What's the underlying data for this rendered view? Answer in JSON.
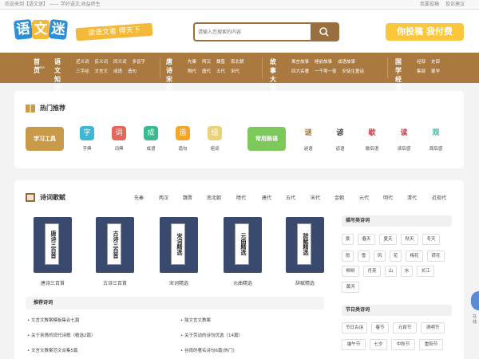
{
  "topbar": {
    "welcome": "欢迎来到【语文迷】 —— 学好语文,收益终生",
    "links": [
      "我要投稿",
      "投诉建议"
    ]
  },
  "header": {
    "logo": [
      "语",
      "文",
      "迷"
    ],
    "slogan": "读语文者 得天下",
    "search_placeholder": "请输入您搜索的内容",
    "submit": "你投稿 我付费"
  },
  "nav": [
    {
      "main": "首页",
      "sub": "Home",
      "links": []
    },
    {
      "main": "语文",
      "main2": "知识",
      "links": [
        [
          "近义词",
          "反义词",
          "同义词",
          "多音字"
        ],
        [
          "三字经",
          "文言文",
          "成语",
          "造句"
        ]
      ]
    },
    {
      "main": "唐诗",
      "main2": "宋词",
      "links": [
        [
          "先秦",
          "两汉",
          "魏晋",
          "南北朝"
        ],
        [
          "隋代",
          "唐代",
          "五代",
          "宋代"
        ]
      ]
    },
    {
      "main": "故事",
      "main2": "大全",
      "links": [
        [
          "寓言故事",
          "睡前故事",
          "成语故事"
        ],
        [
          "四大名著",
          "一千零一夜",
          "安徒生童话"
        ]
      ]
    },
    {
      "main": "国学",
      "main2": "经典",
      "links": [
        [
          "经部",
          "史部"
        ],
        [
          "集部",
          "蒙学"
        ]
      ]
    }
  ],
  "hot": {
    "title": "热门推荐",
    "tool_btn": "学习工具",
    "idiom_btn": "常用熟语",
    "tools": [
      {
        "label": "字典",
        "glyph": "字",
        "color": "#3cb8d6"
      },
      {
        "label": "词典",
        "glyph": "词",
        "color": "#e6665c"
      },
      {
        "label": "成语",
        "glyph": "成",
        "color": "#3cba8f"
      },
      {
        "label": "造句",
        "glyph": "造",
        "color": "#f5a623"
      },
      {
        "label": "组词",
        "glyph": "组",
        "color": "#e9d27a"
      }
    ],
    "idioms": [
      {
        "label": "谜语",
        "glyph": "谜",
        "color": "#a8793f"
      },
      {
        "label": "谚语",
        "glyph": "谚",
        "color": "#444"
      },
      {
        "label": "歇后语",
        "glyph": "歇",
        "color": "#d9333f"
      },
      {
        "label": "读后感",
        "glyph": "读",
        "color": "#d9333f"
      },
      {
        "label": "观后感",
        "glyph": "观",
        "color": "#3cb8a6"
      }
    ]
  },
  "poems": {
    "title": "诗词歌赋",
    "tabs": [
      "先秦",
      "两汉",
      "魏晋",
      "南北朝",
      "隋代",
      "唐代",
      "五代",
      "宋代",
      "金朝",
      "元代",
      "明代",
      "清代",
      "近现代"
    ],
    "books": [
      {
        "cover": "唐诗三百首",
        "name": "唐诗三百首"
      },
      {
        "cover": "古诗三百首",
        "name": "古诗三百首"
      },
      {
        "cover": "宋词精选",
        "name": "宋词精选"
      },
      {
        "cover": "元曲精选",
        "name": "元曲精选"
      },
      {
        "cover": "辞赋精选",
        "name": "辞赋精选"
      }
    ],
    "rec_title": "推荐诗词",
    "rec": [
      "文言文教案模板集合七篇",
      "独文言文教案",
      "关于亲情的现代诗歌（精选2篇）",
      "关于劳动的诗句优选（14篇）",
      "文言文教案范文合集5篇",
      "谷雨的著名诗句6篇(热门)"
    ],
    "side1": "描写类诗词",
    "chips1": [
      "景",
      "春天",
      "夏天",
      "秋天",
      "冬天",
      "雨",
      "雪",
      "风",
      "花",
      "梅花",
      "荷花",
      "柳树",
      "月亮",
      "山",
      "水",
      "长江",
      "黄河"
    ],
    "side2": "节日类诗词",
    "chips2": [
      "节日古诗",
      "春节",
      "元宵节",
      "清明节",
      "端午节",
      "七夕",
      "中秋节",
      "重阳节"
    ],
    "float": "在线"
  }
}
